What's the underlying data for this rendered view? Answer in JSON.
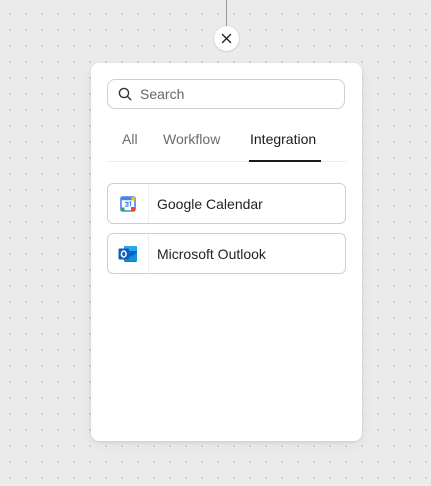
{
  "search": {
    "placeholder": "Search"
  },
  "tabs": [
    {
      "label": "All",
      "active": false
    },
    {
      "label": "Workflow",
      "active": false
    },
    {
      "label": "Integration",
      "active": true
    }
  ],
  "integrations": [
    {
      "label": "Google Calendar",
      "icon": "google-calendar-icon"
    },
    {
      "label": "Microsoft Outlook",
      "icon": "microsoft-outlook-icon"
    }
  ],
  "colors": {
    "canvas_background": "#ebebeb",
    "canvas_dots": "#d2d2d2",
    "panel_background": "#ffffff",
    "active_tab": "#1a1a1a",
    "inactive_tab": "#6b6b6b",
    "border": "#cfcfcf"
  }
}
